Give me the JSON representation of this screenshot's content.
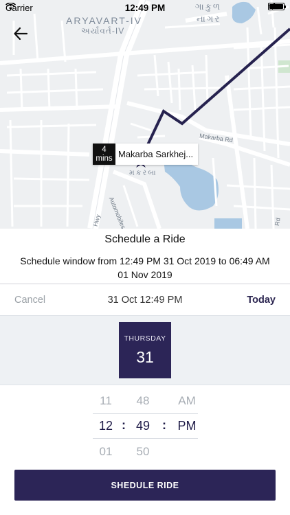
{
  "status_bar": {
    "carrier": "Carrier",
    "time": "12:49 PM"
  },
  "map": {
    "labels": {
      "aryavart_en": "ARYAVART-IV",
      "aryavart_gu": "અર્યાવર્ત-IV",
      "gokul_gu": "ગાકુળ",
      "nagar_gu": "નાગર",
      "makarba_gu": "મકરબા",
      "makarba_rd": "Makarba Rd",
      "automobiles_rd": "Automobiles Rd",
      "hwy": "Hwy",
      "rd": "Rd"
    },
    "eta": {
      "value": "4",
      "unit": "mins",
      "place": "Makarba Sarkhej..."
    },
    "colors": {
      "route": "#26224f",
      "water": "#a9c8e3",
      "road": "#ffffff",
      "land": "#eef0f2"
    }
  },
  "sheet": {
    "title": "Schedule a Ride",
    "window_line1": "Schedule window from 12:49 PM 31 Oct 2019 to 06:49 AM",
    "window_line2": "01 Nov 2019"
  },
  "picker": {
    "cancel_label": "Cancel",
    "selected_summary": "31 Oct 12:49 PM",
    "today_label": "Today",
    "day": {
      "name": "THURSDAY",
      "number": "31"
    },
    "hours": [
      "11",
      "12",
      "01"
    ],
    "minutes": [
      "48",
      "49",
      "50"
    ],
    "ampm": [
      "AM",
      "PM"
    ],
    "separator": ":"
  },
  "submit_label": "SHEDULE RIDE",
  "colors": {
    "accent": "#2c2557",
    "muted": "#9aa0a6"
  }
}
